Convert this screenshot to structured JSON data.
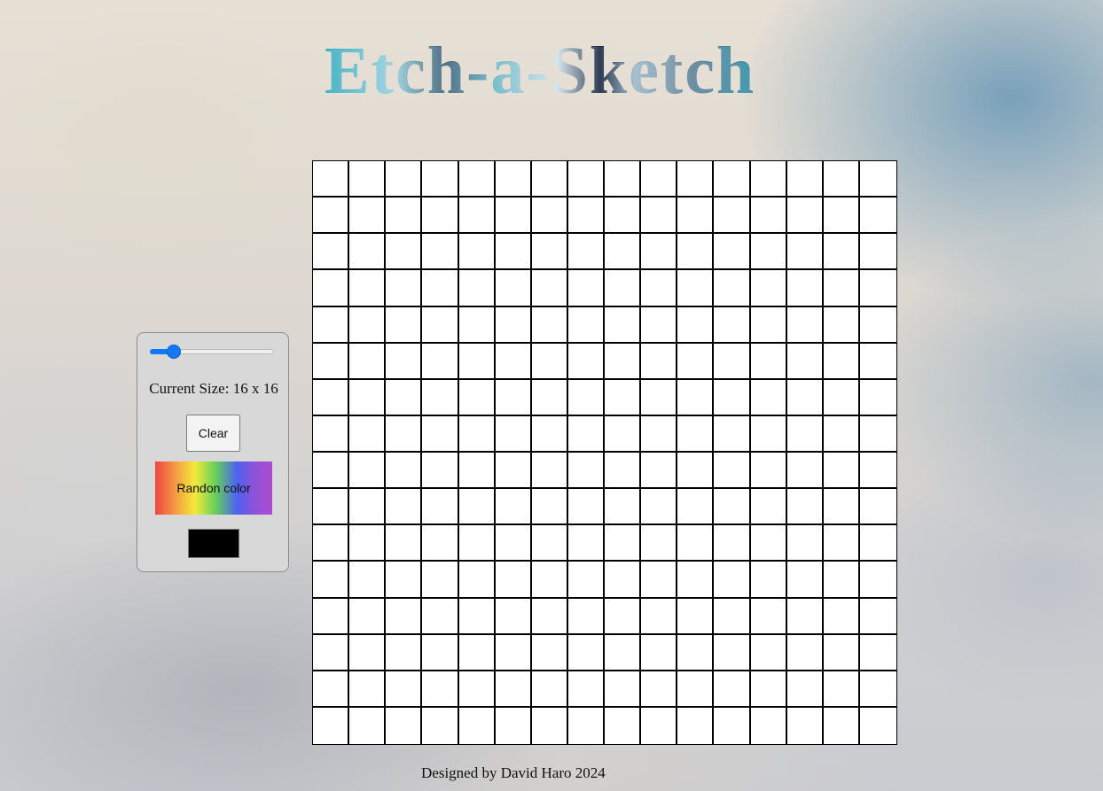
{
  "header": {
    "title": "Etch-a-Sketch"
  },
  "controls": {
    "slider": {
      "value": 16
    },
    "size_label": "Current Size: 16 x 16",
    "clear_label": "Clear",
    "random_color_label": "Randon color",
    "current_color": "#000000",
    "accent_color": "#1478f2"
  },
  "grid": {
    "rows": 16,
    "columns": 16,
    "cell_color": "#ffffff",
    "line_color": "#000000"
  },
  "footer": {
    "credit": "Designed by David Haro 2024"
  }
}
